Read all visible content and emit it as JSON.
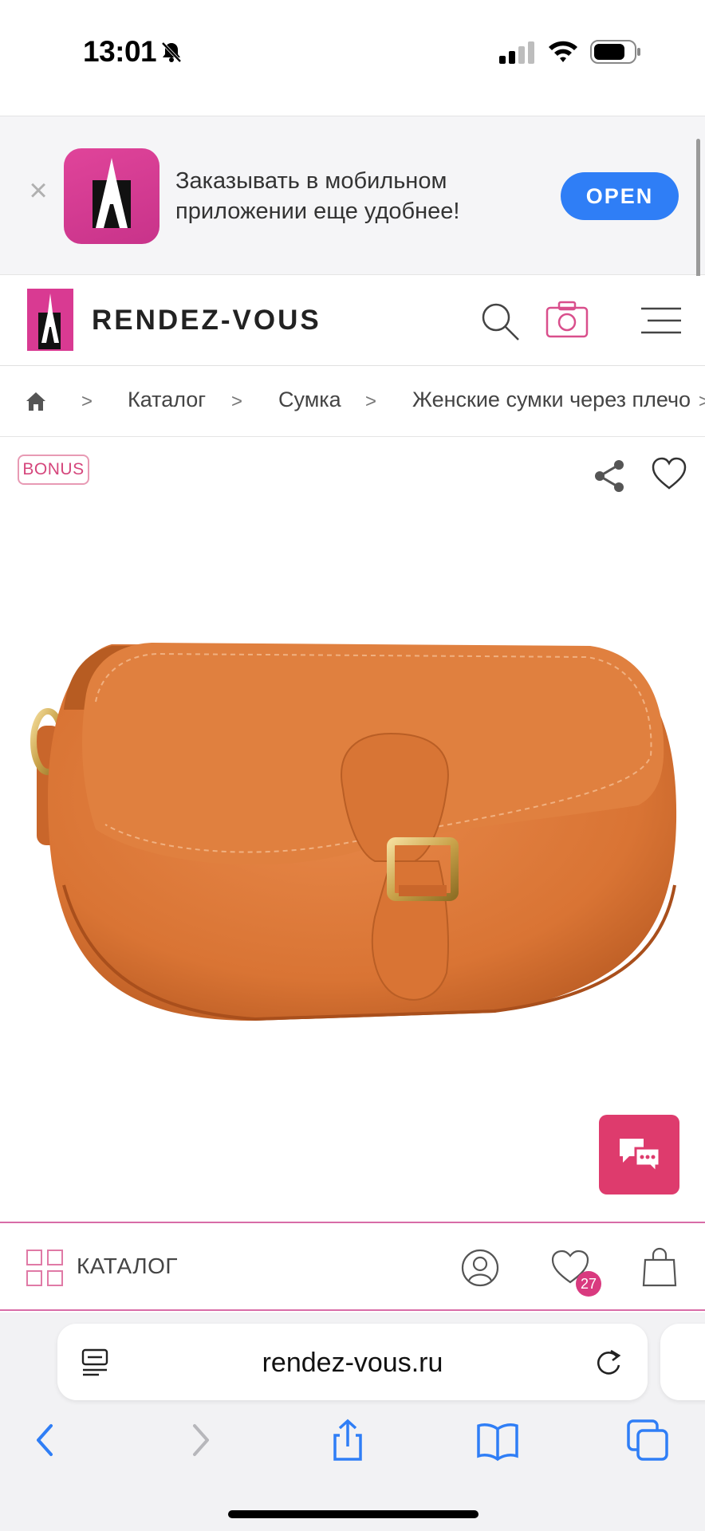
{
  "status_bar": {
    "time": "13:01"
  },
  "smart_banner": {
    "message": "Заказывать в мобильном приложении еще удобнее!",
    "open_label": "OPEN"
  },
  "header": {
    "brand": "RENDEZ-VOUS",
    "logo_text": "Rendez-Vous"
  },
  "breadcrumb": {
    "items": [
      "Каталог",
      "Сумка",
      "Женские сумки через плечо"
    ],
    "separator": ">"
  },
  "product": {
    "badge": "BONUS",
    "image_description": "orange suede crossbody bag"
  },
  "bottom_nav": {
    "catalog_label": "КАТАЛОГ",
    "favorites_count": "27"
  },
  "browser": {
    "url": "rendez-vous.ru"
  },
  "colors": {
    "accent_pink": "#de3b6d",
    "ios_blue": "#2f7ef6",
    "brand_magenta": "#d93a92"
  }
}
